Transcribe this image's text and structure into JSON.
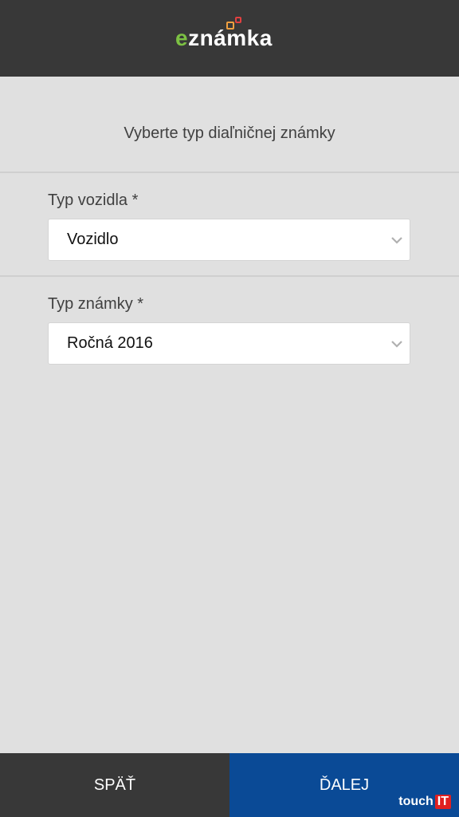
{
  "header": {
    "logo_text_e": "e",
    "logo_text_rest": "známka"
  },
  "main": {
    "subtitle": "Vyberte typ diaľničnej známky",
    "vehicle_type": {
      "label": "Typ vozidla *",
      "value": "Vozidlo"
    },
    "stamp_type": {
      "label": "Typ známky *",
      "value": "Ročná 2016"
    }
  },
  "footer": {
    "back_label": "SPÄŤ",
    "next_label": "ĎALEJ"
  },
  "watermark": {
    "prefix": "touch",
    "suffix": "IT"
  },
  "colors": {
    "header_bg": "#383838",
    "next_button_bg": "#0a4a96",
    "logo_accent": "#7cc143"
  }
}
